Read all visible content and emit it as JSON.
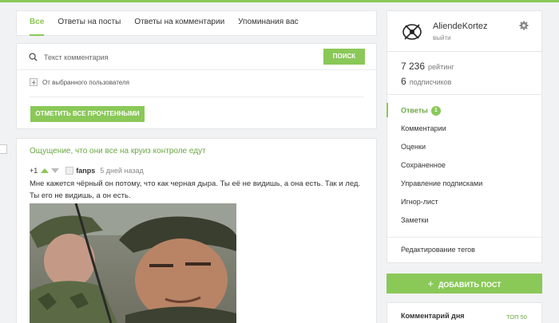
{
  "tabs": [
    {
      "label": "Все",
      "active": true
    },
    {
      "label": "Ответы на посты"
    },
    {
      "label": "Ответы на комментарии"
    },
    {
      "label": "Упоминания вас"
    }
  ],
  "search": {
    "placeholder": "Текст комментария",
    "button_label": "ПОИСК"
  },
  "filter": {
    "label": "От выбранного пользователя"
  },
  "mark_read_label": "ОТМЕТИТЬ ВСЕ ПРОЧТЕННЫМИ",
  "post": {
    "title": "Ощущение, что они все на круиз контроле едут",
    "rating": "+1",
    "author": "fanps",
    "time": "5 дней назад",
    "text": "Мне кажется чёрный он потому, что как черная дыра. Ты её не видишь, а она есть. Так и лед. Ты его не видишь, а он есть."
  },
  "user": {
    "name": "AliendeKortez",
    "logout": "выйти"
  },
  "stats": {
    "rating_value": "7 236",
    "rating_label": "рейтинг",
    "subs_value": "6",
    "subs_label": "подписчиков"
  },
  "menu": {
    "replies": "Ответы",
    "replies_badge": "1",
    "comments": "Комментарии",
    "ratings": "Оценки",
    "saved": "Сохраненное",
    "subscriptions": "Управление подписками",
    "ignore": "Игнор-лист",
    "notes": "Заметки",
    "tag_edit": "Редактирование тегов"
  },
  "add_post_label": "ДОБАВИТЬ ПОСТ",
  "comment_of_day": {
    "title": "Комментарий дня",
    "link": "ТОП 50"
  },
  "colors": {
    "accent": "#8ac858",
    "link": "#6aa843",
    "background": "#f1f2f4"
  }
}
